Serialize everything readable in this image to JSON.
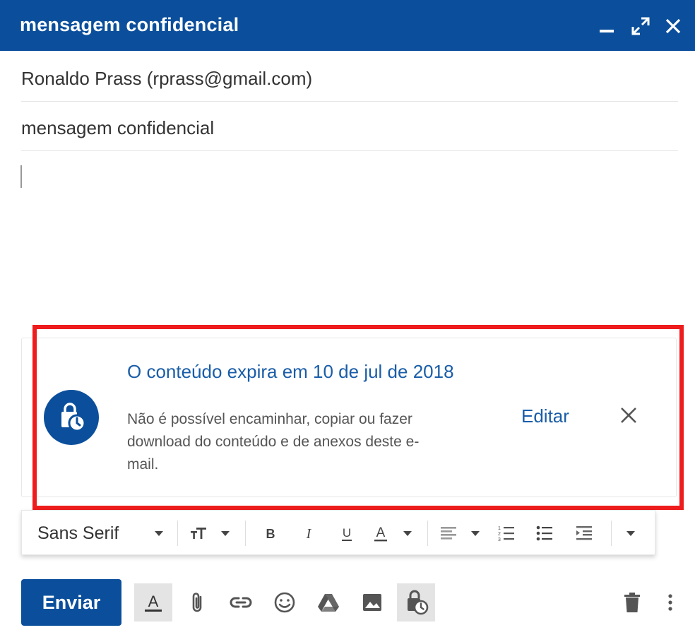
{
  "window": {
    "title": "mensagem confidencial",
    "controls": [
      "minimize-icon",
      "expand-icon",
      "close-icon"
    ]
  },
  "compose": {
    "to": "Ronaldo Prass (rprass@gmail.com)",
    "subject": "mensagem confidencial",
    "body": ""
  },
  "banner": {
    "title": "O conteúdo expira em 10 de jul de 2018",
    "description": "Não é possível encaminhar, copiar ou fazer download do conteúdo e de anexos deste e-mail.",
    "edit_label": "Editar",
    "icon": "confidential-mode-icon",
    "highlight_color": "#ee1c1c"
  },
  "format_toolbar": {
    "font": "Sans Serif",
    "tools": [
      "text-size-icon",
      "bold-icon",
      "italic-icon",
      "underline-icon",
      "text-color-icon",
      "align-icon",
      "numbered-list-icon",
      "bulleted-list-icon",
      "indent-icon",
      "more-formatting-icon"
    ]
  },
  "actions": {
    "send_label": "Enviar",
    "tools": [
      "formatting-options-icon",
      "attach-icon",
      "link-icon",
      "emoji-icon",
      "drive-icon",
      "photo-icon",
      "confidential-mode-icon",
      "trash-icon",
      "more-options-icon"
    ]
  },
  "colors": {
    "accent": "#0b4f9c",
    "link": "#1a5da8"
  }
}
